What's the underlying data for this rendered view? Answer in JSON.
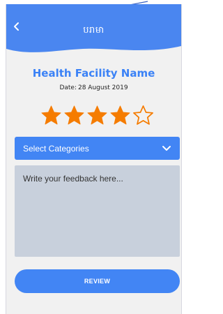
{
  "header": {
    "title": "បរាមា",
    "back_icon": "chevron-left-icon",
    "color": "#4a86f0"
  },
  "facility": {
    "name": "Health Facility Name",
    "date_label": "Date:",
    "date": "28 August 2019"
  },
  "rating": {
    "value": 4,
    "max": 5,
    "filled_color": "#f57c00"
  },
  "category_select": {
    "label": "Select Categories",
    "icon": "chevron-down-icon"
  },
  "feedback": {
    "placeholder": "Write your feedback here...",
    "value": ""
  },
  "review_button": {
    "label": "REVIEW"
  },
  "colors": {
    "accent": "#4285f4",
    "background": "#f1f1f1",
    "textarea_bg": "#c8d0dc"
  }
}
